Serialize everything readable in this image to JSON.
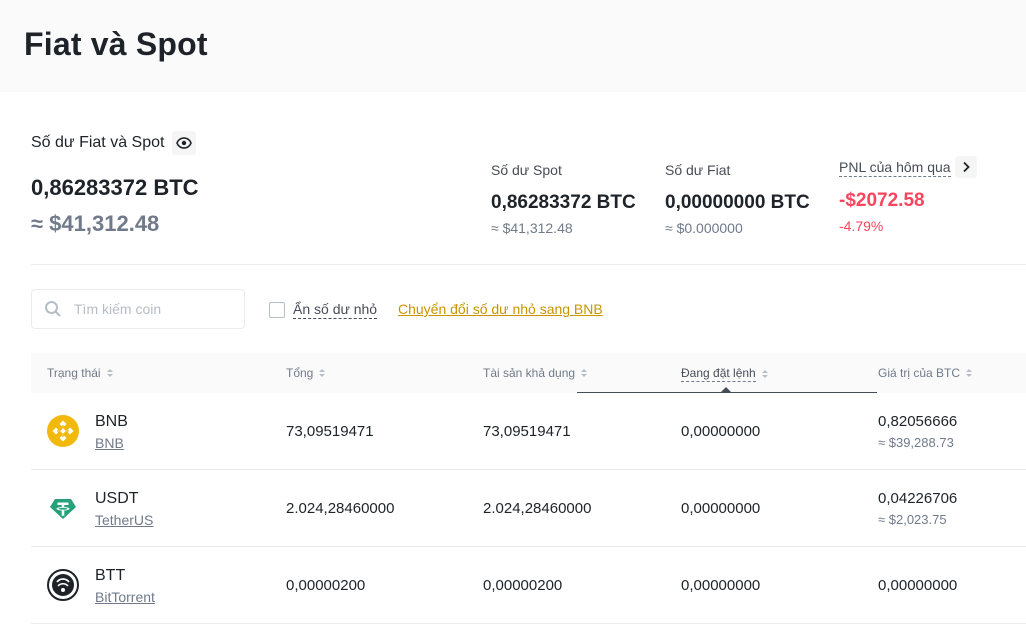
{
  "header": {
    "title": "Fiat và Spot"
  },
  "balance": {
    "label": "Số dư Fiat và Spot",
    "total_btc": "0,86283372 BTC",
    "total_usd": "≈ $41,312.48"
  },
  "stats": {
    "spot": {
      "label": "Số dư Spot",
      "value": "0,86283372 BTC",
      "sub": "≈ $41,312.48"
    },
    "fiat": {
      "label": "Số dư Fiat",
      "value": "0,00000000 BTC",
      "sub": "≈ $0.000000"
    },
    "pnl": {
      "label": "PNL của hôm qua",
      "value": "-$2072.58",
      "sub": "-4.79%"
    }
  },
  "filters": {
    "search_placeholder": "Tìm kiếm coin",
    "hide_small_label": "Ẩn số dư nhỏ",
    "convert_link": "Chuyển đổi số dư nhỏ sang BNB"
  },
  "table": {
    "columns": [
      "Trạng thái",
      "Tổng",
      "Tài sản khả dụng",
      "Đang đặt lệnh",
      "Giá trị của BTC"
    ],
    "rows": [
      {
        "symbol": "BNB",
        "name": "BNB",
        "total": "73,09519471",
        "available": "73,09519471",
        "in_order": "0,00000000",
        "btc_value": "0,82056666",
        "usd_value": "≈ $39,288.73"
      },
      {
        "symbol": "USDT",
        "name": "TetherUS",
        "total": "2.024,28460000",
        "available": "2.024,28460000",
        "in_order": "0,00000000",
        "btc_value": "0,04226706",
        "usd_value": "≈ $2,023.75"
      },
      {
        "symbol": "BTT",
        "name": "BitTorrent",
        "total": "0,00000200",
        "available": "0,00000200",
        "in_order": "0,00000000",
        "btc_value": "0,00000000",
        "usd_value": ""
      }
    ]
  },
  "colors": {
    "negative": "#f6465d",
    "link": "#c99400",
    "bnb": "#f0b90b",
    "usdt": "#26a17b"
  },
  "icons": [
    "eye-icon",
    "chevron-right-icon",
    "search-icon",
    "sort-icon",
    "bnb-logo-icon",
    "usdt-logo-icon",
    "btt-logo-icon"
  ]
}
